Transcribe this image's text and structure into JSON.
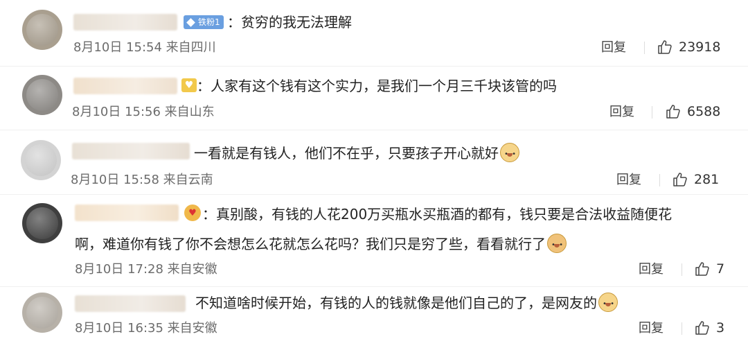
{
  "reply_label": "回复",
  "colon": "：",
  "comments": [
    {
      "badge": "铁粉1",
      "text": "贫穷的我无法理解",
      "date": "8月10日 15:54 来自四川",
      "likes": "23918"
    },
    {
      "text": "人家有这个钱有这个实力，是我们一个月三千块该管的吗",
      "date": "8月10日 15:56 来自山东",
      "likes": "6588"
    },
    {
      "text": "一看就是有钱人，他们不在乎，只要孩子开心就好",
      "date": "8月10日 15:58 来自云南",
      "likes": "281"
    },
    {
      "text_line1": "真别酸，有钱的人花200万买瓶水买瓶酒的都有，钱只要是合法收益随便花",
      "text_line2": "啊，难道你有钱了你不会想怎么花就怎么花吗？我们只是穷了些，看看就行了",
      "date": "8月10日 17:28 来自安徽",
      "likes": "7"
    },
    {
      "text": "不知道啥时候开始，有钱的人的钱就像是他们自己的了，是网友的",
      "date": "8月10日 16:35 来自安徽",
      "likes": "3"
    }
  ]
}
